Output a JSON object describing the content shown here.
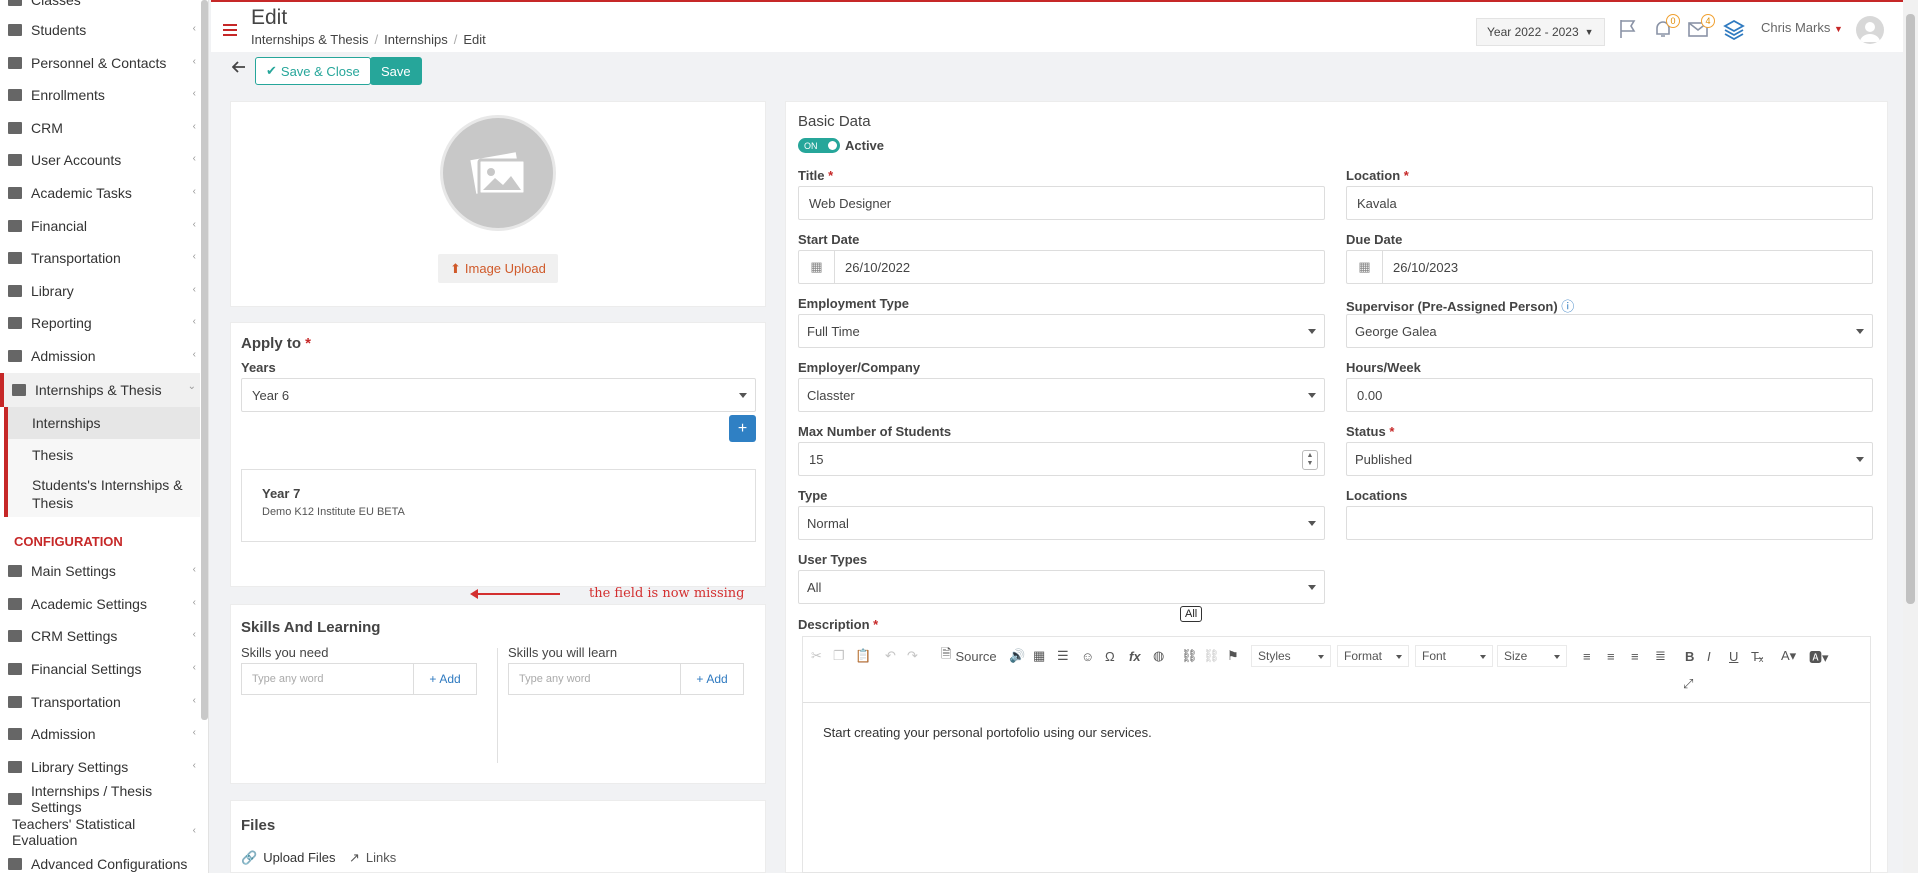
{
  "sidebar": {
    "items": [
      {
        "label": "Classes",
        "icon": "classes-icon"
      },
      {
        "label": "Students",
        "icon": "students-icon"
      },
      {
        "label": "Personnel & Contacts",
        "icon": "personnel-icon"
      },
      {
        "label": "Enrollments",
        "icon": "enrollments-icon"
      },
      {
        "label": "CRM",
        "icon": "crm-icon"
      },
      {
        "label": "User Accounts",
        "icon": "user-accounts-icon"
      },
      {
        "label": "Academic Tasks",
        "icon": "academic-tasks-icon"
      },
      {
        "label": "Financial",
        "icon": "financial-icon"
      },
      {
        "label": "Transportation",
        "icon": "bus-icon"
      },
      {
        "label": "Library",
        "icon": "library-icon"
      },
      {
        "label": "Reporting",
        "icon": "reporting-icon"
      },
      {
        "label": "Admission",
        "icon": "admission-icon"
      },
      {
        "label": "Internships & Thesis",
        "icon": "internships-icon"
      }
    ],
    "sub_items": [
      "Internships",
      "Thesis",
      "Students's Internships & Thesis"
    ],
    "config_heading": "CONFIGURATION",
    "config_items": [
      {
        "label": "Main Settings",
        "icon": "main-settings-icon"
      },
      {
        "label": "Academic Settings",
        "icon": "academic-settings-icon"
      },
      {
        "label": "CRM Settings",
        "icon": "crm-settings-icon"
      },
      {
        "label": "Financial Settings",
        "icon": "financial-settings-icon"
      },
      {
        "label": "Transportation",
        "icon": "bus-icon"
      },
      {
        "label": "Admission",
        "icon": "admission-icon"
      },
      {
        "label": "Library Settings",
        "icon": "library-settings-icon"
      },
      {
        "label": "Internships / Thesis Settings",
        "icon": "internships-settings-icon"
      },
      {
        "label": "Teachers' Statistical Evaluation",
        "icon": ""
      },
      {
        "label": "Advanced Configurations",
        "icon": "gears-icon"
      }
    ]
  },
  "header": {
    "title": "Edit",
    "breadcrumb": [
      "Internships & Thesis",
      "Internships",
      "Edit"
    ],
    "year": "Year 2022 - 2023",
    "notifications_count": "0",
    "messages_count": "4",
    "user": "Chris Marks"
  },
  "toolbar": {
    "save_close": "Save & Close",
    "save": "Save"
  },
  "left": {
    "image_upload": "Image Upload",
    "apply_to_title": "Apply to",
    "years_label": "Years",
    "years_value": "Year 6",
    "year_card_title": "Year 7",
    "year_card_subtitle": "Demo K12 Institute EU BETA",
    "annotation": "the field is now missing",
    "skills_title": "Skills And Learning",
    "skills_need_label": "Skills you need",
    "skills_learn_label": "Skills you will learn",
    "skills_placeholder": "Type any word",
    "add_label": "Add",
    "files_title": "Files",
    "upload_files": "Upload Files",
    "links": "Links"
  },
  "basic": {
    "title": "Basic Data",
    "toggle": "ON",
    "active": "Active",
    "fields": {
      "title_label": "Title",
      "title_value": "Web Designer",
      "location_label": "Location",
      "location_value": "Kavala",
      "start_label": "Start Date",
      "start_value": "26/10/2022",
      "due_label": "Due Date",
      "due_value": "26/10/2023",
      "emp_type_label": "Employment Type",
      "emp_type_value": "Full Time",
      "supervisor_label": "Supervisor (Pre-Assigned Person)",
      "supervisor_value": "George Galea",
      "employer_label": "Employer/Company",
      "employer_value": "Classter",
      "hours_label": "Hours/Week",
      "hours_value": "0.00",
      "max_label": "Max Number of Students",
      "max_value": "15",
      "status_label": "Status",
      "status_value": "Published",
      "type_label": "Type",
      "type_value": "Normal",
      "locations_label": "Locations",
      "locations_value": "",
      "user_types_label": "User Types",
      "user_types_value": "All",
      "tooltip": "All",
      "description_label": "Description"
    }
  },
  "editor": {
    "source": "Source",
    "styles": "Styles",
    "format": "Format",
    "font": "Font",
    "size": "Size",
    "content": "Start creating your personal portofolio using our services."
  }
}
